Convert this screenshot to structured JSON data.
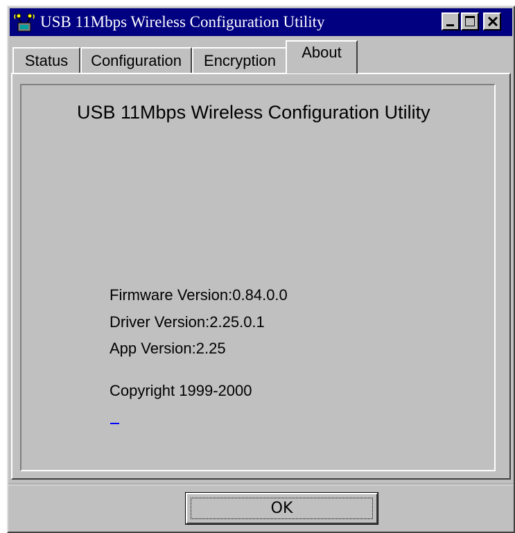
{
  "window": {
    "title": "USB 11Mbps Wireless Configuration Utility"
  },
  "tabs": [
    {
      "label": "Status"
    },
    {
      "label": "Configuration"
    },
    {
      "label": "Encryption"
    },
    {
      "label": "About",
      "selected": true
    }
  ],
  "about": {
    "title": "USB 11Mbps Wireless Configuration Utility",
    "firmware_version": "Firmware Version:0.84.0.0",
    "driver_version": "Driver Version:2.25.0.1",
    "app_version": "App Version:2.25",
    "copyright": "Copyright 1999-2000"
  },
  "footer": {
    "ok_label": "OK"
  },
  "colors": {
    "titlebar": "#000080",
    "face": "#c0c0c0",
    "link": "#0000ff"
  },
  "icons": [
    "wireless-app-icon",
    "minimize-icon",
    "maximize-icon",
    "close-icon"
  ]
}
